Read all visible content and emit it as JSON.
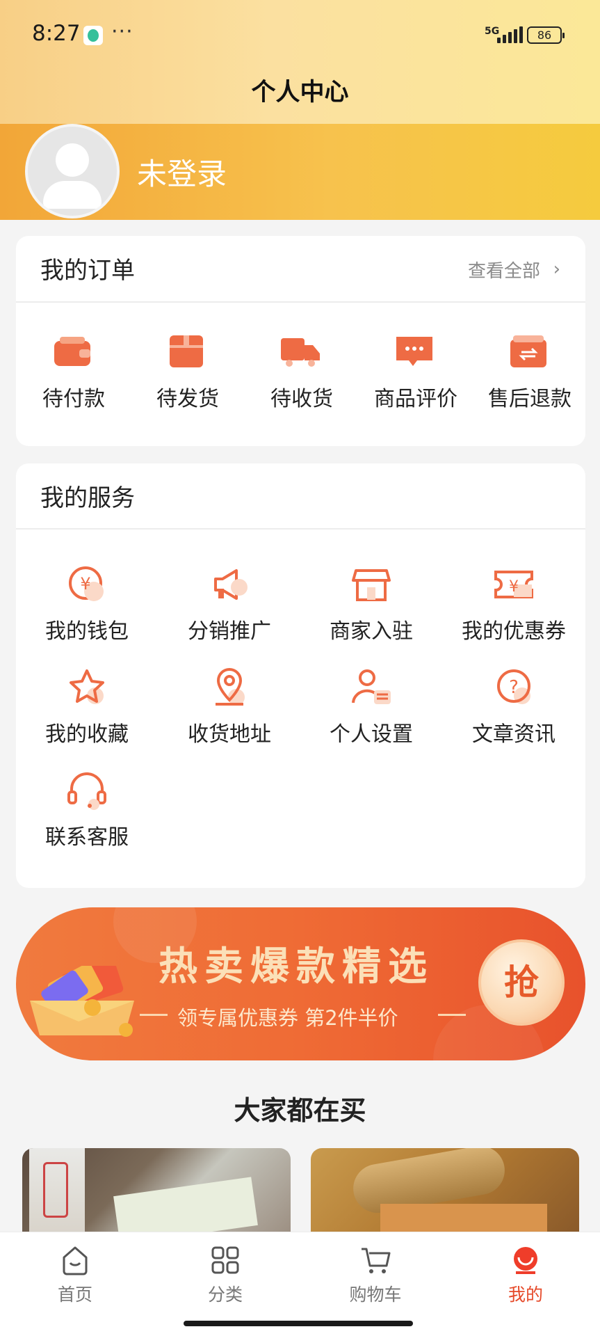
{
  "status_bar": {
    "time": "8:27",
    "dots": "···",
    "network": "5G",
    "battery": "86"
  },
  "header": {
    "title": "个人中心",
    "login_text": "未登录"
  },
  "orders": {
    "title": "我的订单",
    "view_all": "查看全部",
    "items": [
      {
        "label": "待付款",
        "icon": "wallet-icon"
      },
      {
        "label": "待发货",
        "icon": "package-icon"
      },
      {
        "label": "待收货",
        "icon": "truck-icon"
      },
      {
        "label": "商品评价",
        "icon": "comment-icon"
      },
      {
        "label": "售后退款",
        "icon": "refund-icon"
      }
    ]
  },
  "services": {
    "title": "我的服务",
    "items": [
      {
        "label": "我的钱包",
        "icon": "wallet-coin-icon"
      },
      {
        "label": "分销推广",
        "icon": "megaphone-icon"
      },
      {
        "label": "商家入驻",
        "icon": "store-icon"
      },
      {
        "label": "我的优惠券",
        "icon": "coupon-icon"
      },
      {
        "label": "我的收藏",
        "icon": "star-icon"
      },
      {
        "label": "收货地址",
        "icon": "location-icon"
      },
      {
        "label": "个人设置",
        "icon": "user-settings-icon"
      },
      {
        "label": "文章资讯",
        "icon": "question-icon"
      },
      {
        "label": "联系客服",
        "icon": "headset-icon"
      }
    ]
  },
  "banner": {
    "title": "热卖爆款精选",
    "subtitle": "领专属优惠券 第2件半价",
    "button": "抢"
  },
  "section": {
    "title": "大家都在买"
  },
  "bottom_nav": {
    "items": [
      {
        "label": "首页",
        "icon": "home-icon"
      },
      {
        "label": "分类",
        "icon": "grid-icon"
      },
      {
        "label": "购物车",
        "icon": "cart-icon"
      },
      {
        "label": "我的",
        "icon": "profile-icon"
      }
    ],
    "active": "我的"
  },
  "colors": {
    "accent": "#ef6b40",
    "brand_orange": "#f2a638",
    "active_nav": "#e64a2a"
  }
}
